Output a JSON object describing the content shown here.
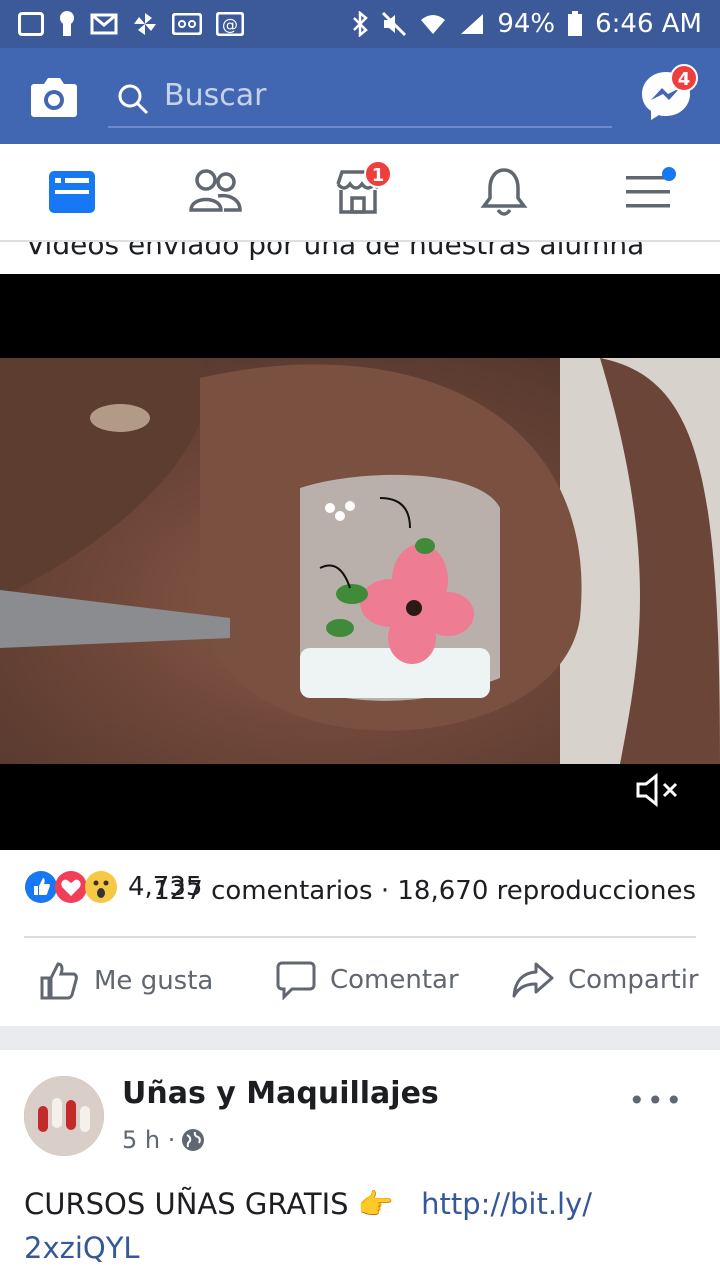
{
  "status_bar": {
    "battery": "94%",
    "time": "6:46 AM"
  },
  "top_bar": {
    "search_placeholder": "Buscar",
    "messenger_badge": "4"
  },
  "nav": {
    "marketplace_badge": "1"
  },
  "post": {
    "partial_caption": "Videos enviado por una de nuestras alumna",
    "reactions_count": "4,735",
    "stats": "127 comentarios · 18,670 reproducciones",
    "actions": {
      "like": "Me gusta",
      "comment": "Comentar",
      "share": "Compartir"
    }
  },
  "post2": {
    "author": "Uñas y Maquillajes",
    "time": "5 h ·",
    "text": "CURSOS UÑAS GRATIS",
    "emoji": "👉",
    "link_part1": "http://bit.ly/",
    "link_part2": "2xziQYL"
  },
  "colors": {
    "fb_blue": "#4267b2",
    "status_blue": "#3c5a99",
    "badge_red": "#f03d3d"
  }
}
